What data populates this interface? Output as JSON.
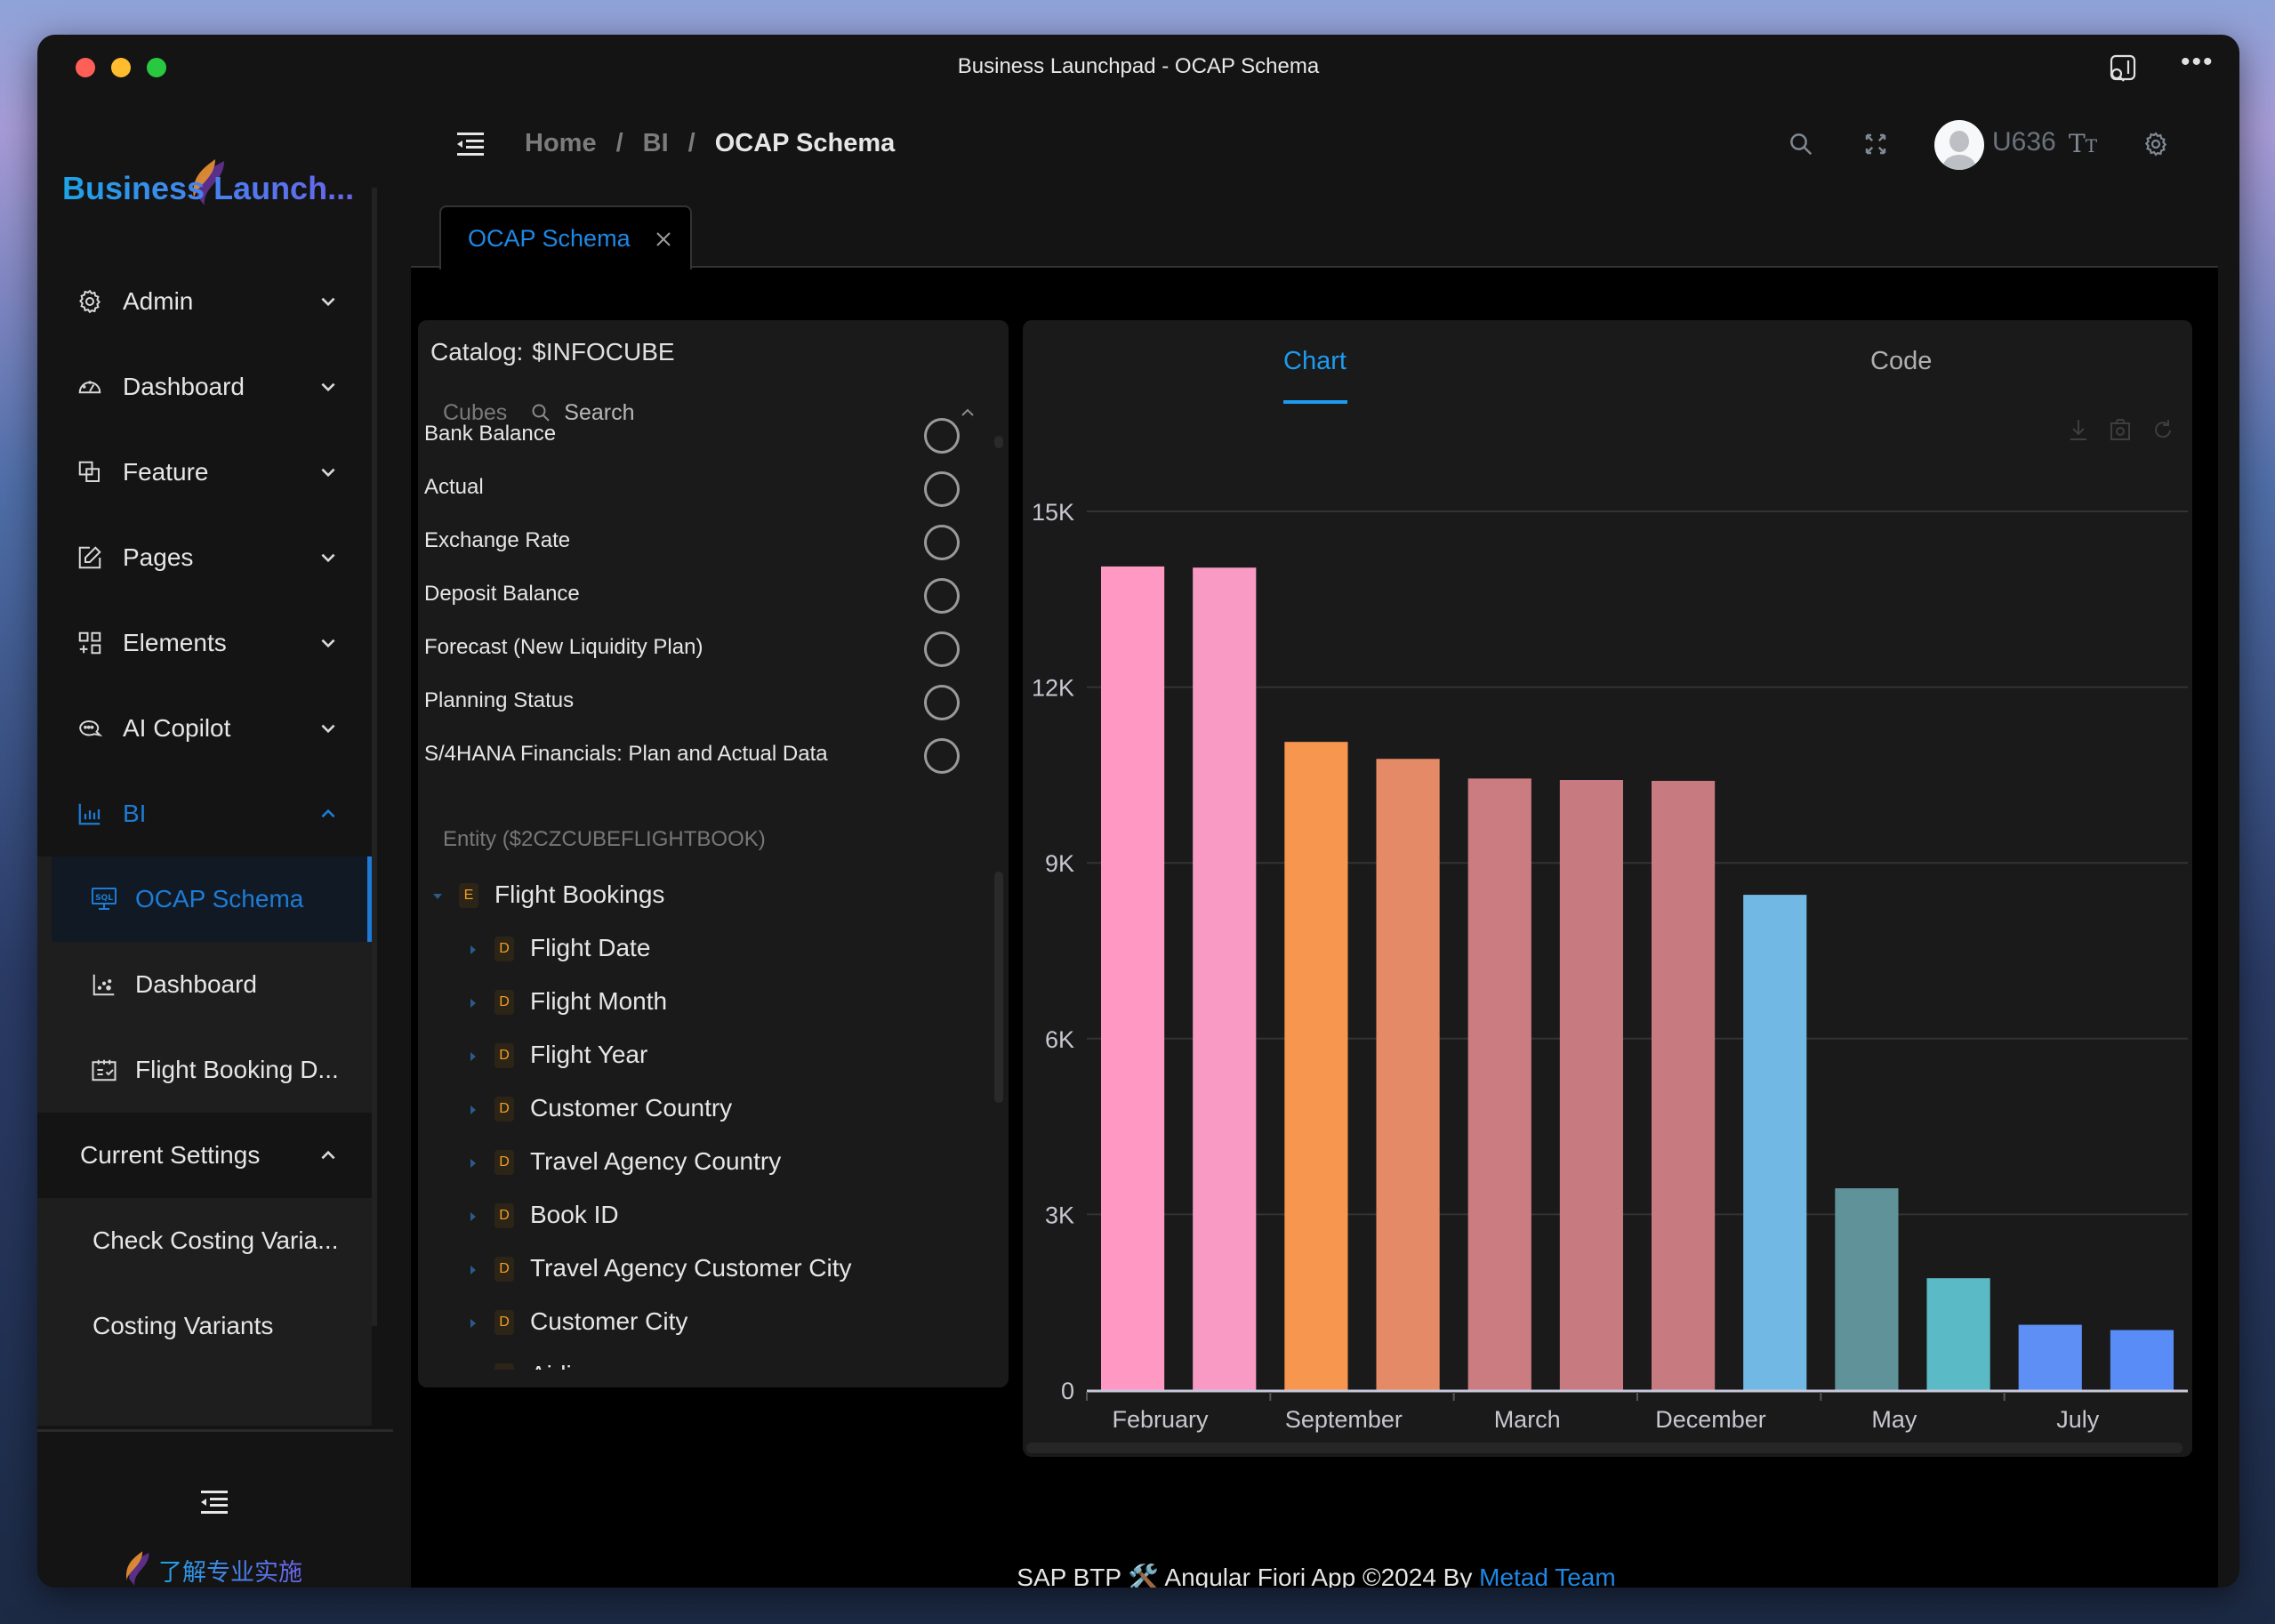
{
  "window": {
    "title": "Business Launchpad - OCAP Schema"
  },
  "sidebar": {
    "brand": "Business Launch...",
    "menu": [
      {
        "label": "Admin",
        "icon": "gear-icon",
        "expanded": false
      },
      {
        "label": "Dashboard",
        "icon": "speedometer-icon",
        "expanded": false
      },
      {
        "label": "Feature",
        "icon": "feature-icon",
        "expanded": false
      },
      {
        "label": "Pages",
        "icon": "edit-icon",
        "expanded": false
      },
      {
        "label": "Elements",
        "icon": "grid-add-icon",
        "expanded": false
      },
      {
        "label": "AI Copilot",
        "icon": "chat-icon",
        "expanded": false
      },
      {
        "label": "BI",
        "icon": "bar-chart-icon",
        "expanded": true
      }
    ],
    "bi_items": [
      {
        "label": "OCAP Schema",
        "icon": "sql-monitor-icon",
        "selected": true
      },
      {
        "label": "Dashboard",
        "icon": "scatter-chart-icon",
        "selected": false
      },
      {
        "label": "Flight Booking D...",
        "icon": "calendar-check-icon",
        "selected": false
      }
    ],
    "current_settings": {
      "label": "Current Settings",
      "expanded": true,
      "items": [
        {
          "label": "Check Costing Varia..."
        },
        {
          "label": "Costing Variants"
        }
      ]
    },
    "footer_link": "了解专业实施"
  },
  "header": {
    "breadcrumb": [
      "Home",
      "BI",
      "OCAP Schema"
    ],
    "breadcrumb_separator": "/",
    "user": "U636",
    "font_icon_glyph": "TT"
  },
  "tabs": [
    {
      "label": "OCAP Schema",
      "active": true
    }
  ],
  "schema": {
    "catalog_label": "Catalog:",
    "catalog_value": "$INFOCUBE",
    "cubes_label": "Cubes",
    "search_placeholder": "Search",
    "cubes": [
      {
        "label": "Bank Balance",
        "selected": false
      },
      {
        "label": "Actual",
        "selected": false
      },
      {
        "label": "Exchange Rate",
        "selected": false
      },
      {
        "label": "Deposit Balance",
        "selected": false
      },
      {
        "label": "Forecast (New Liquidity Plan)",
        "selected": false
      },
      {
        "label": "Planning Status",
        "selected": false
      },
      {
        "label": "S/4HANA Financials: Plan and Actual Data",
        "selected": false
      }
    ],
    "entity_title": "Entity ($2CZCUBEFLIGHTBOOK)",
    "tree": [
      {
        "label": "Flight Bookings",
        "badge": "E",
        "level": 0,
        "expanded": true
      },
      {
        "label": "Flight Date",
        "badge": "D",
        "level": 1
      },
      {
        "label": "Flight Month",
        "badge": "D",
        "level": 1
      },
      {
        "label": "Flight Year",
        "badge": "D",
        "level": 1
      },
      {
        "label": "Customer Country",
        "badge": "D",
        "level": 1
      },
      {
        "label": "Travel Agency Country",
        "badge": "D",
        "level": 1
      },
      {
        "label": "Book ID",
        "badge": "D",
        "level": 1
      },
      {
        "label": "Travel Agency Customer City",
        "badge": "D",
        "level": 1
      },
      {
        "label": "Customer City",
        "badge": "D",
        "level": 1
      },
      {
        "label": "Airline",
        "badge": "D",
        "level": 1
      }
    ]
  },
  "chart_panel": {
    "tabs": [
      {
        "label": "Chart",
        "active": true
      },
      {
        "label": "Code",
        "active": false
      }
    ],
    "toolbox": [
      "download-icon",
      "camera-icon",
      "refresh-icon"
    ]
  },
  "chart_data": {
    "type": "bar",
    "title": "",
    "xlabel": "",
    "ylabel": "",
    "ylim": [
      0,
      15000
    ],
    "yticks": [
      0,
      3000,
      6000,
      9000,
      12000,
      15000
    ],
    "ytick_labels": [
      "0",
      "3K",
      "6K",
      "9K",
      "12K",
      "15K"
    ],
    "grid": true,
    "categories": [
      "February",
      null,
      "September",
      null,
      "March",
      null,
      "December",
      null,
      "May",
      null,
      "July",
      null
    ],
    "values": [
      14060,
      14040,
      11065,
      10775,
      10440,
      10415,
      10400,
      8455,
      3445,
      1910,
      1115,
      1025
    ],
    "colors": [
      "#ff99c3",
      "#f99ac4",
      "#f7964e",
      "#e58a67",
      "#cb7c80",
      "#c77a7f",
      "#c87a81",
      "#72b8e4",
      "#5f9399",
      "#5abbc6",
      "#5e8ff5",
      "#5a8cf7"
    ]
  },
  "footer": {
    "text": "SAP BTP 🛠️ Angular Fiori App ©2024 By ",
    "link": "Metad Team"
  }
}
